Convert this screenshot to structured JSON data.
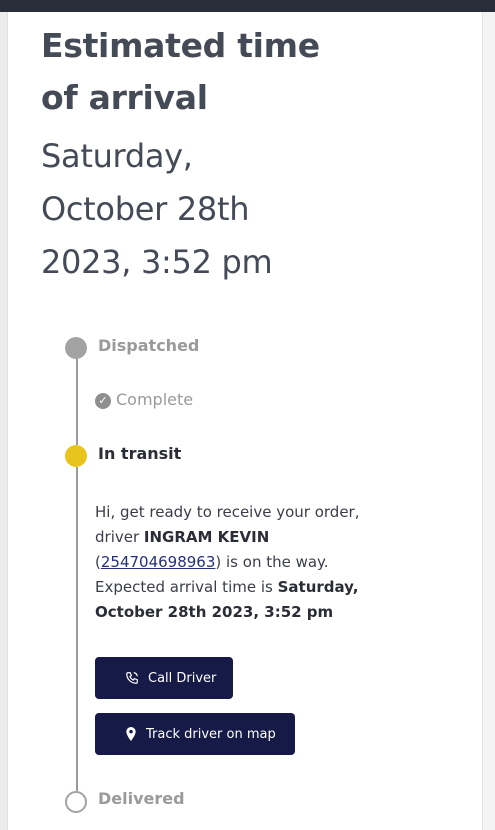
{
  "eta": {
    "title_line1": "Estimated time",
    "title_line2": "of arrival",
    "value_line1": "Saturday,",
    "value_line2": "October 28th",
    "value_line3": "2023, 3:52 pm"
  },
  "timeline": {
    "dispatched": {
      "label": "Dispatched",
      "status": "Complete",
      "icon": "check-circle-icon"
    },
    "in_transit": {
      "label": "In transit",
      "message_prefix": "Hi, get ready to receive your order, driver ",
      "driver_name": "INGRAM KEVIN",
      "phone_open": "(",
      "driver_phone": "254704698963",
      "phone_close_suffix": ") is on the way. Expected arrival time is ",
      "expected_time": "Saturday, October 28th 2023, 3:52 pm"
    },
    "delivered": {
      "label": "Delivered"
    }
  },
  "actions": {
    "call_driver_label": "Call Driver",
    "call_driver_icon": "phone-icon",
    "track_driver_label": "Track driver on map",
    "track_driver_icon": "map-pin-icon"
  },
  "colors": {
    "accent_button": "#161a47",
    "in_transit_dot": "#e8c51c",
    "inactive_dot": "#a3a3a3"
  }
}
